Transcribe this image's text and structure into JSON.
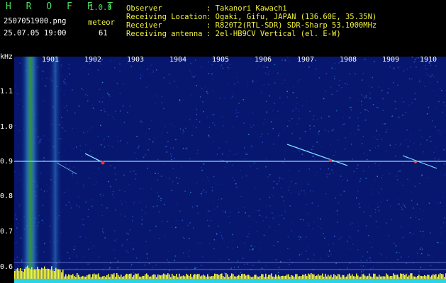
{
  "app": {
    "title": "H R O F F T",
    "version": "1.0.0",
    "filename": "2507051900.png",
    "datetime": "25.07.05 19:00",
    "meteor_label": "meteor",
    "meteor_count": "61"
  },
  "info": {
    "rows": [
      {
        "label": "Observer",
        "value": ": Takanori Kawachi"
      },
      {
        "label": "Receiving Location",
        "value": ": Ogaki, Gifu, JAPAN (136.60E, 35.35N)"
      },
      {
        "label": "Receiver",
        "value": ": R820T2(RTL-SDR) SDR-Sharp 53.1000MHz"
      },
      {
        "label": "Receiving antenna",
        "value": ": 2el-HB9CV Vertical (el. E-W)"
      }
    ]
  },
  "axes": {
    "y_unit": "kHz",
    "y_ticks": [
      "1.1",
      "1.0",
      "0.9",
      "0.8",
      "0.7",
      "0.6"
    ],
    "x_ticks": [
      "1901",
      "1902",
      "1903",
      "1904",
      "1905",
      "1906",
      "1907",
      "1908",
      "1909",
      "1910"
    ]
  },
  "colors": {
    "background": "#07166e",
    "carrier": "#7fe0ff",
    "meteor": "#ff3030",
    "noise_band": "#3a9f3a",
    "power_bar": "#f2f23a"
  }
}
